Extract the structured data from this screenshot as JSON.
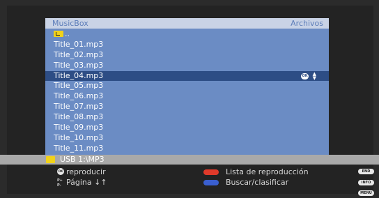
{
  "header": {
    "app_title": "MusicBox",
    "section": "Archivos"
  },
  "files": [
    {
      "name": "..",
      "type": "parent-folder"
    },
    {
      "name": "Title_01.mp3"
    },
    {
      "name": "Title_02.mp3"
    },
    {
      "name": "Title_03.mp3"
    },
    {
      "name": "Title_04.mp3",
      "selected": true
    },
    {
      "name": "Title_05.mp3"
    },
    {
      "name": "Title_06.mp3"
    },
    {
      "name": "Title_07.mp3"
    },
    {
      "name": "Title_08.mp3"
    },
    {
      "name": "Title_09.mp3"
    },
    {
      "name": "Title_10.mp3"
    },
    {
      "name": "Title_11.mp3"
    }
  ],
  "selected_badge": "OK",
  "path": "USB 1:\\MP3",
  "help": {
    "ok_key": "OK",
    "play_label": "reproducir",
    "page_key_top": "P+",
    "page_key_bottom": "P-",
    "page_label": "Página ↓↑",
    "red_label": "Lista de reproducción",
    "blue_label": "Buscar/clasificar",
    "end_key": "END",
    "info_key": "INFO",
    "menu_key": "MENU"
  },
  "colors": {
    "panel": "#6b8cc4",
    "selection": "#2d4d85",
    "red_key": "#e03a2a",
    "blue_key": "#3a5fd0",
    "folder": "#f1d21a"
  },
  "icons": {
    "parent_folder": "folder-up-icon",
    "path_folder": "folder-icon",
    "scroll": "up-down-arrows-icon"
  }
}
